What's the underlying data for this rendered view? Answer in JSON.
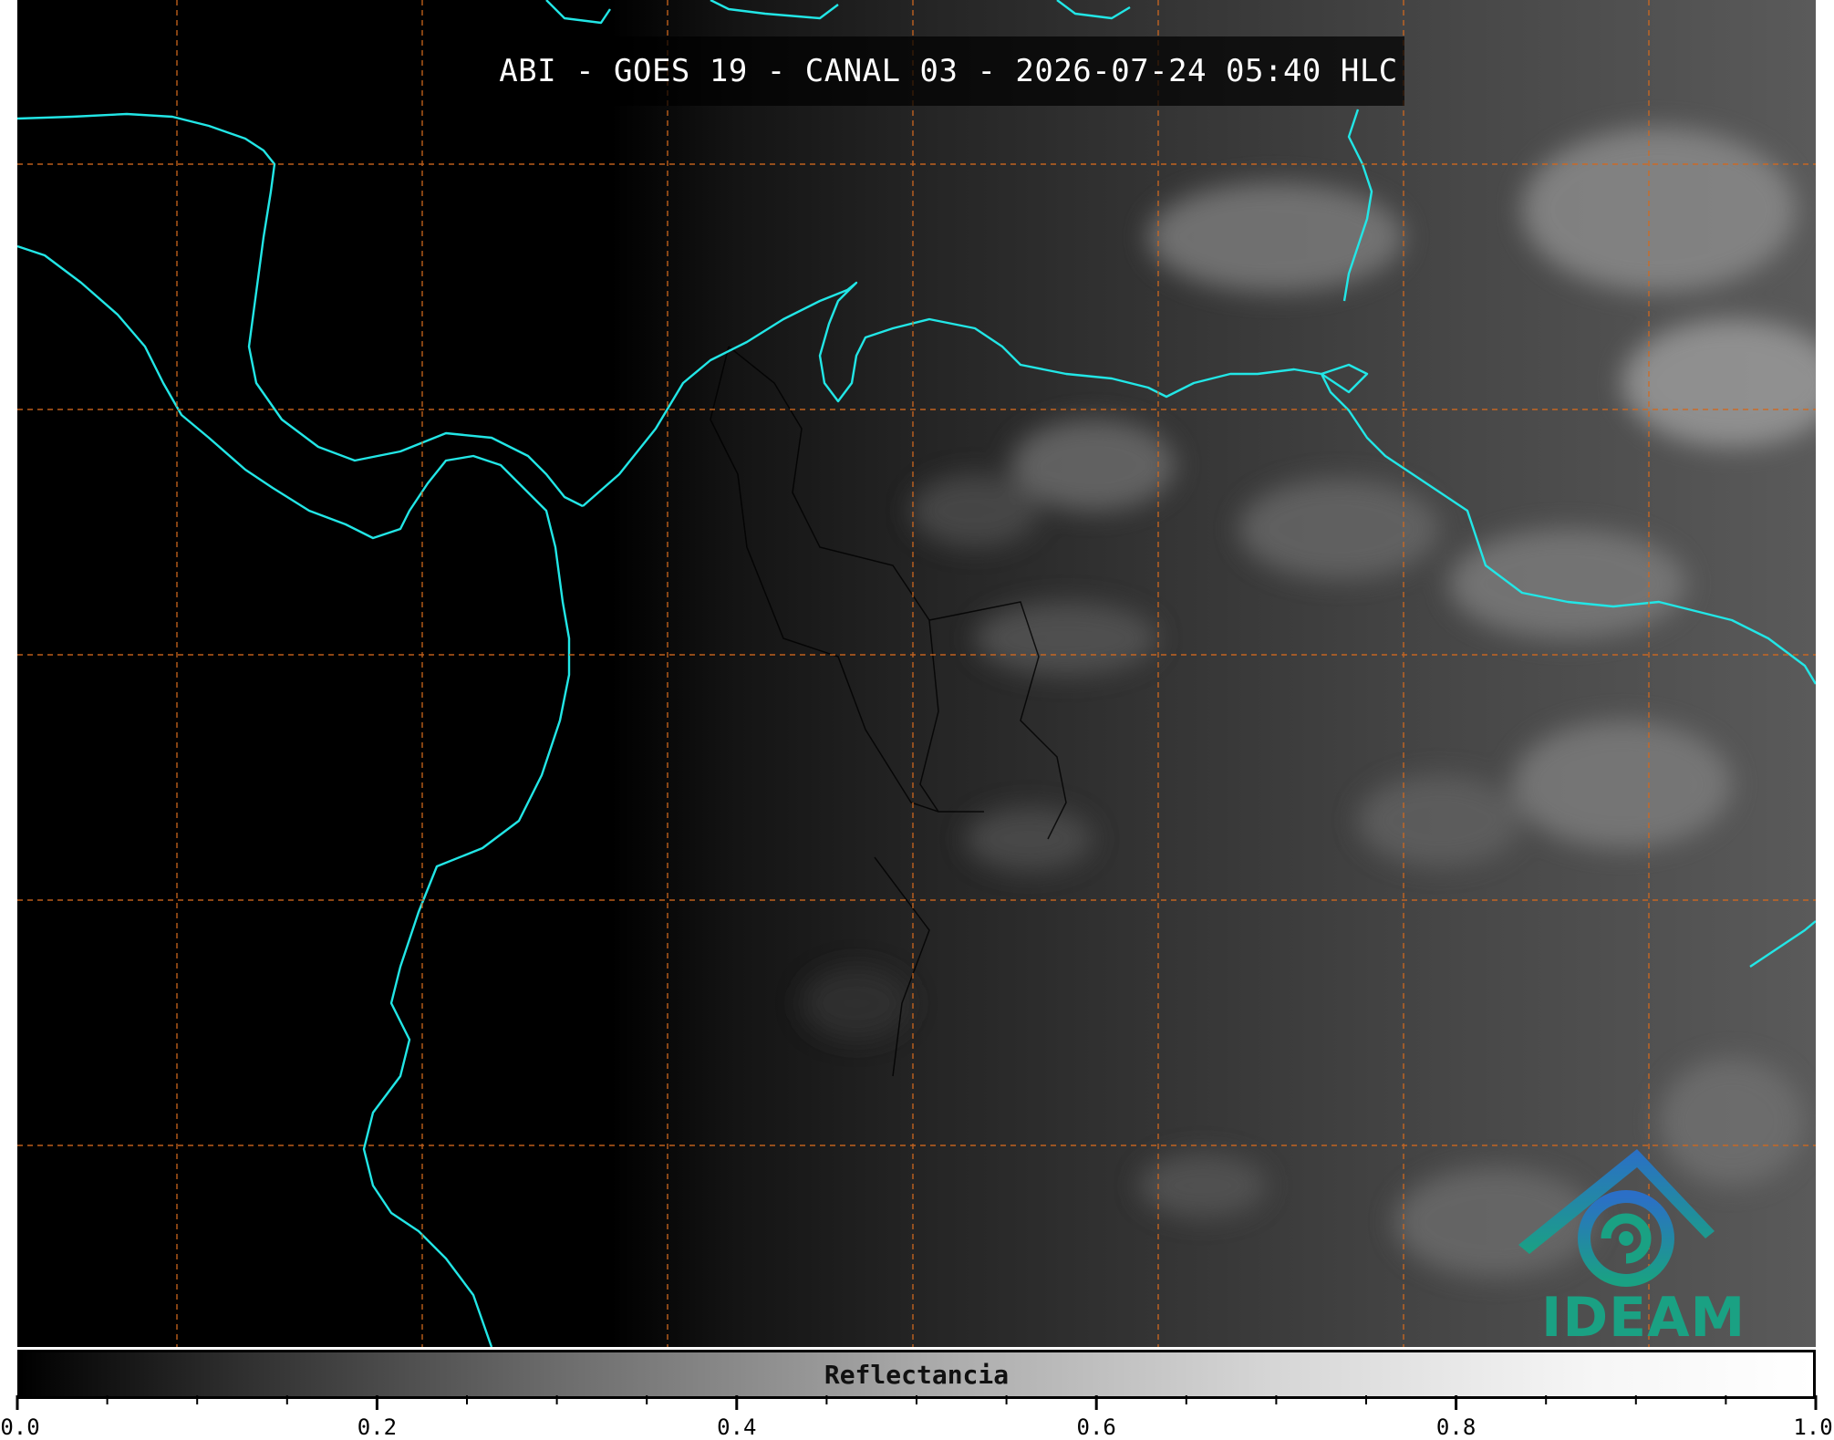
{
  "title": "ABI - GOES 19 - CANAL 03 - 2026-07-24 05:40 HLC",
  "colorbar": {
    "label": "Reflectancia",
    "ticks": [
      "0.0",
      "0.2",
      "0.4",
      "0.6",
      "0.8",
      "1.0"
    ],
    "range": [
      0.0,
      1.0
    ],
    "minor_tick_step": 0.05
  },
  "logo": {
    "text": "IDEAM"
  },
  "colors": {
    "coastline": "#22e6e6",
    "gridlines": "#d2691e",
    "borders": "#000000",
    "logo_text": "#1aa183"
  }
}
